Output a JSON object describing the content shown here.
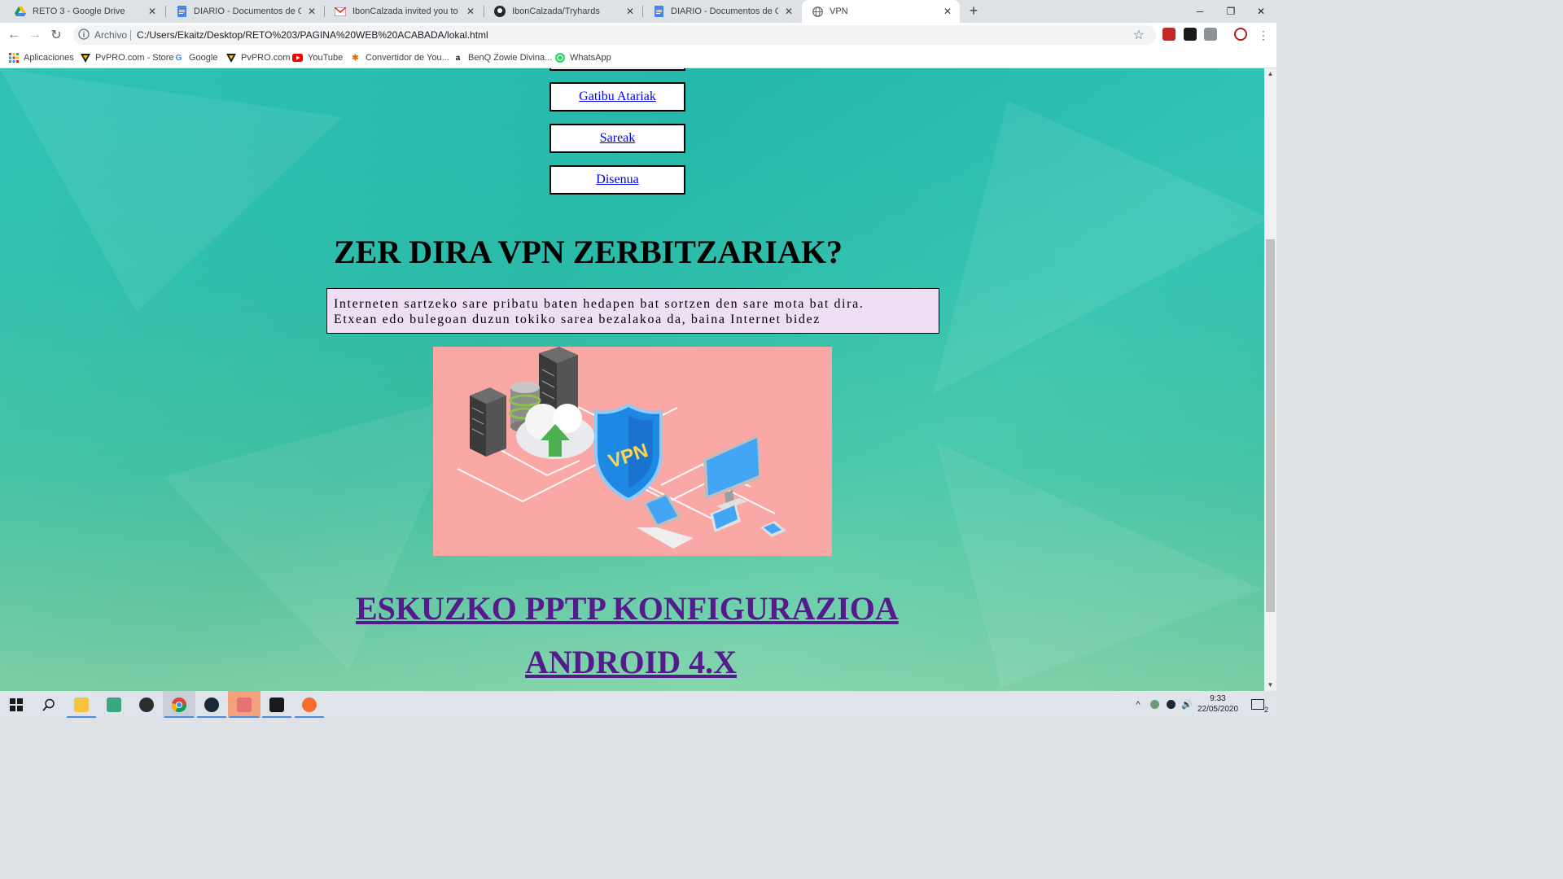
{
  "browser": {
    "tabs": [
      {
        "title": "RETO 3 - Google Drive",
        "icon": "google-drive-icon",
        "active": false
      },
      {
        "title": "DIARIO - Documentos de Google",
        "icon": "google-docs-icon",
        "active": false
      },
      {
        "title": "IbonCalzada invited you to IbonC",
        "icon": "gmail-icon",
        "active": false
      },
      {
        "title": "IbonCalzada/Tryhards",
        "icon": "github-icon",
        "active": false
      },
      {
        "title": "DIARIO - Documentos de Google",
        "icon": "google-docs-icon",
        "active": false
      },
      {
        "title": "VPN",
        "icon": "globe-icon",
        "active": true
      }
    ],
    "new_tab": "+",
    "omnibox": {
      "scheme_label": "Archivo",
      "url": "C:/Users/Ekaitz/Desktop/RETO%203/PAGINA%20WEB%20ACABADA/lokal.html"
    },
    "bookmarks": [
      {
        "label": "Aplicaciones",
        "icon": "apps-grid-icon"
      },
      {
        "label": "PvPRO.com - Store",
        "icon": "pvpro-icon"
      },
      {
        "label": "Google",
        "icon": "google-icon"
      },
      {
        "label": "PvPRO.com",
        "icon": "pvpro-icon"
      },
      {
        "label": "YouTube",
        "icon": "youtube-icon"
      },
      {
        "label": "Convertidor de You...",
        "icon": "converter-icon"
      },
      {
        "label": "BenQ Zowie Divina...",
        "icon": "amazon-icon"
      },
      {
        "label": "WhatsApp",
        "icon": "whatsapp-icon"
      }
    ]
  },
  "page": {
    "nav_links": [
      "Gatibu Atariak",
      "Sareak",
      "Disenua"
    ],
    "heading": "ZER DIRA VPN ZERBITZARIAK?",
    "description_line1": "Interneten sartzeko sare pribatu baten hedapen bat sortzen den sare mota bat dira.",
    "description_line2": "Etxean edo bulegoan duzun tokiko sarea bezalakoa da, baina Internet bidez",
    "hero_shield_text": "VPN",
    "link_title_1": "ESKUZKO PPTP KONFIGURAZIOA",
    "link_title_2": "ANDROID 4.X"
  },
  "taskbar": {
    "clock_time": "9:33",
    "clock_date": "22/05/2020",
    "notification_count": "2"
  },
  "colors": {
    "link": "#0000ee",
    "visited_link": "#551a8b",
    "hero_bg": "#f9a8a6",
    "description_bg": "#efdff5"
  }
}
